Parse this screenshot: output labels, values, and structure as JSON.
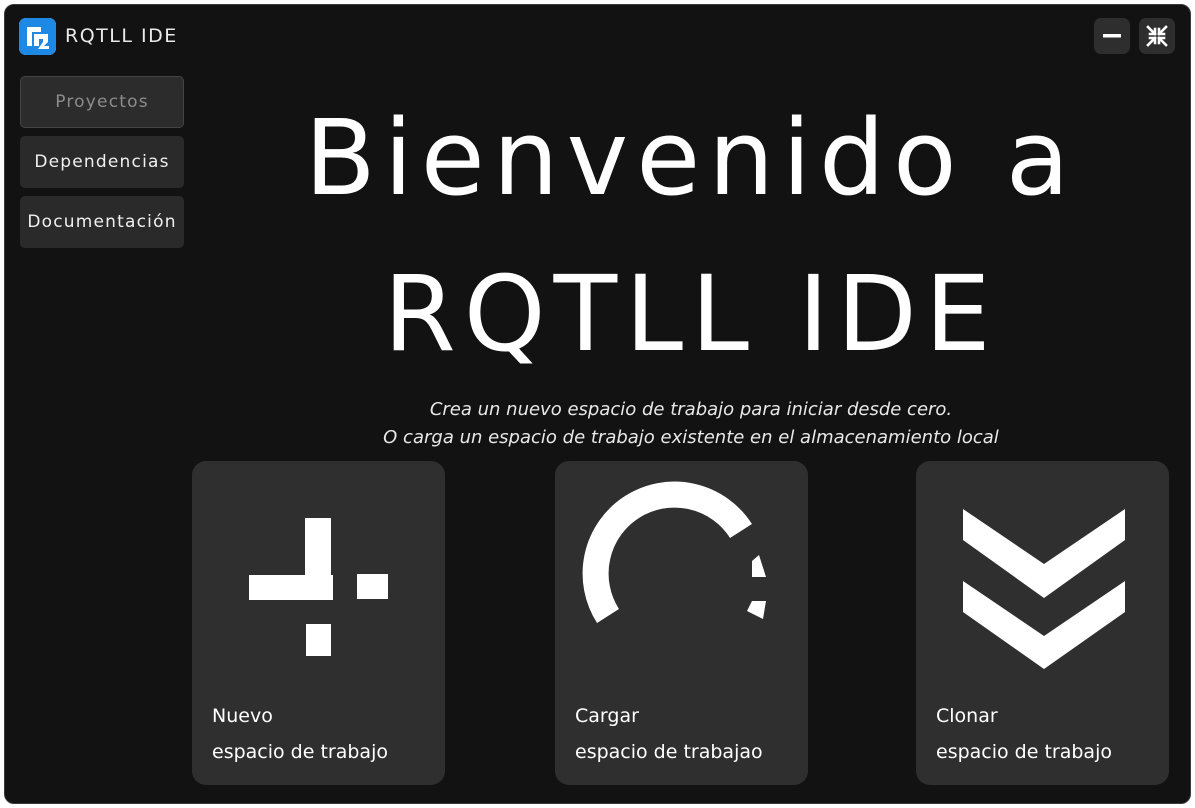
{
  "app": {
    "title": "RQTLL IDE",
    "logo_color": "#1e88e5"
  },
  "window_controls": {
    "minimize_icon": "minus-icon",
    "close_icon": "collapse-arrows-icon"
  },
  "sidebar": {
    "items": [
      {
        "label": "Proyectos",
        "active": true
      },
      {
        "label": "Dependencias",
        "active": false
      },
      {
        "label": "Documentación",
        "active": false
      }
    ]
  },
  "hero": {
    "line1": "Bienvenido a",
    "line2": "RQTLL IDE"
  },
  "subtitle": {
    "line1": "Crea un nuevo espacio de trabajo para iniciar desde cero.",
    "line2": "O carga un espacio de trabajo existente en el almacenamiento local"
  },
  "cards": [
    {
      "title": "Nuevo",
      "subtitle": "espacio de trabajo",
      "icon": "new-workspace-icon"
    },
    {
      "title": "Cargar",
      "subtitle": "espacio de trabajao",
      "icon": "load-workspace-icon"
    },
    {
      "title": "Clonar",
      "subtitle": "espacio de trabajo",
      "icon": "clone-chevrons-icon"
    }
  ],
  "colors": {
    "background": "#121212",
    "card": "#2f2f2f",
    "sidebar_item": "#2a2a2a",
    "text": "#ffffff",
    "muted_text": "#8c8c8c"
  }
}
